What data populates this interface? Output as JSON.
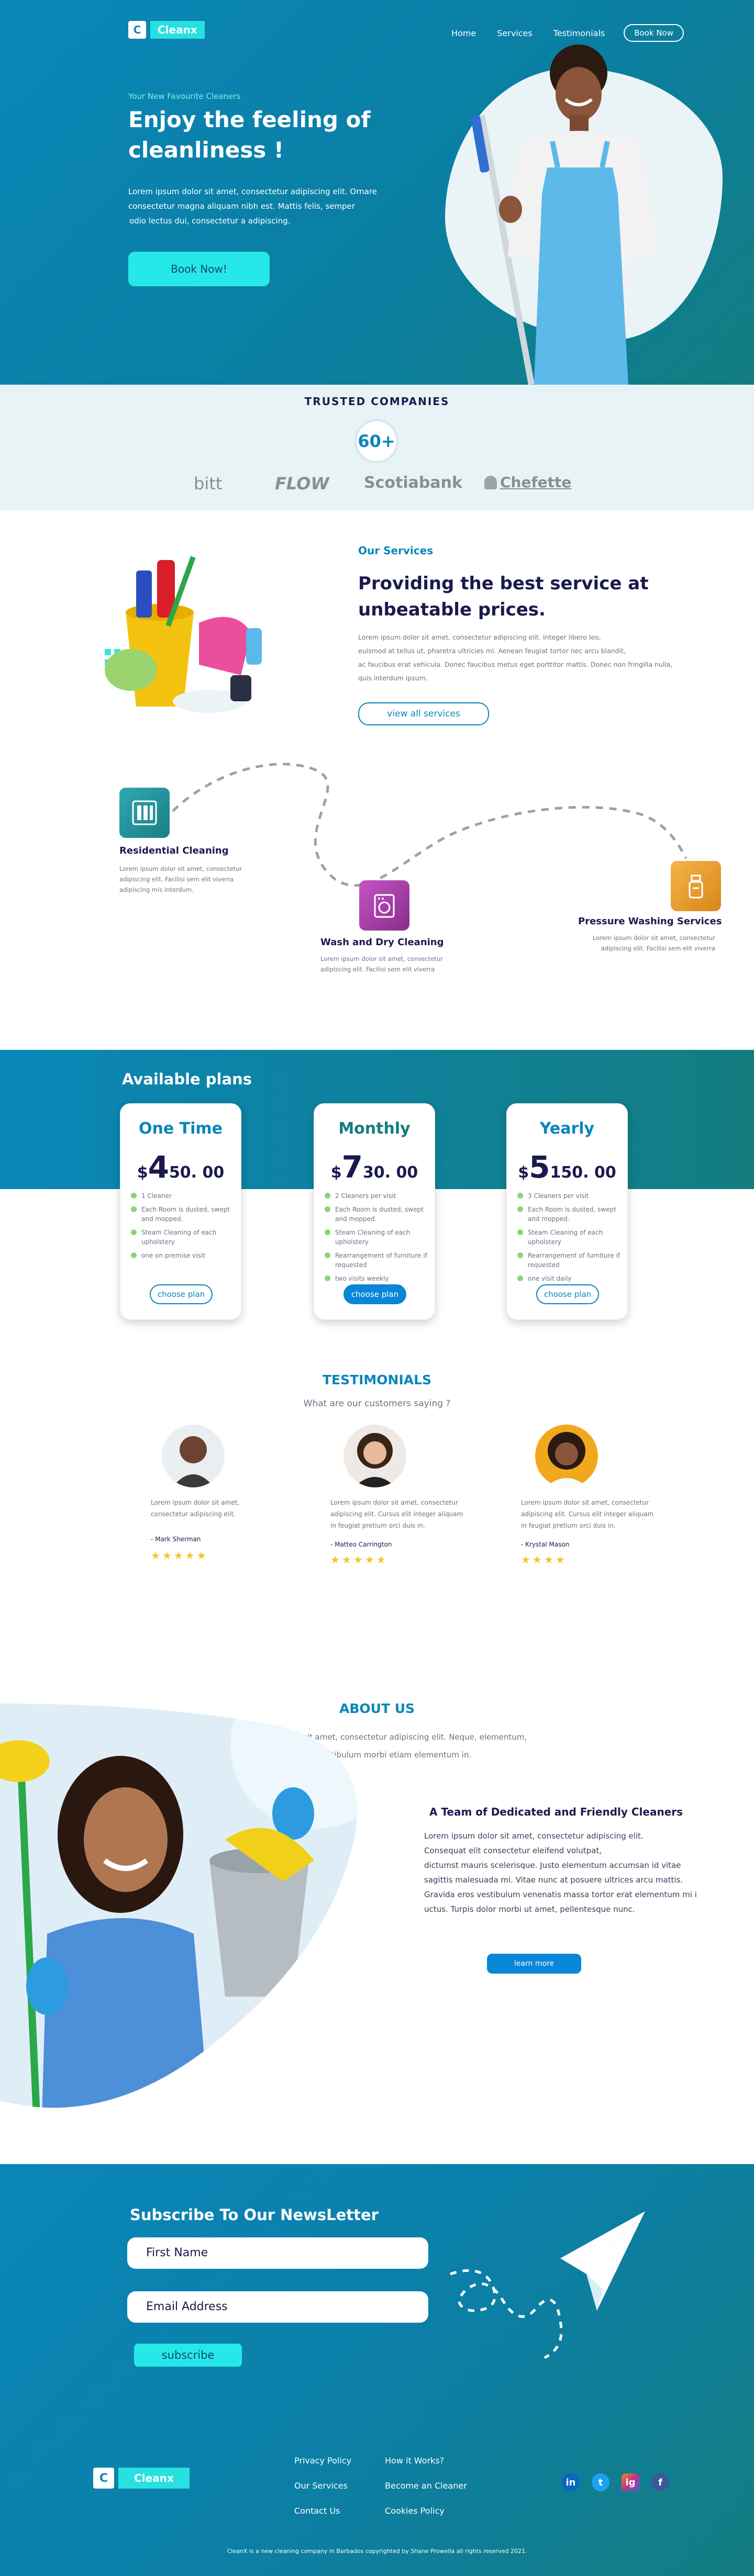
{
  "header": {
    "logo_letter": "C",
    "logo_text": "Cleanx",
    "nav": [
      "Home",
      "Services",
      "Testimonials"
    ],
    "book_label": "Book Now"
  },
  "hero": {
    "eyebrow": "Your New Favourite Cleaners",
    "title_line1": "Enjoy the feeling of",
    "title_line2": "cleanliness !",
    "para_line1": "Lorem ipsum dolor sit amet, consectetur adipiscing elit. Ornare",
    "para_line2": "consectetur magna aliquam nibh est. Mattis felis, semper",
    "para_line3": "odio lectus dui, consectetur a adipiscing.",
    "cta": "Book Now!"
  },
  "trusted": {
    "title": "TRUSTED COMPANIES",
    "count": "60+",
    "brands": [
      "bitt",
      "FLOW",
      "Scotiabank",
      "Chefette"
    ]
  },
  "services": {
    "eyebrow": "Our Services",
    "title_line1": "Providing the best service at",
    "title_line2": "unbeatable prices.",
    "para_line1": "Lorem ipsum dolor sit amet, consectetur adipiscing elit. Integer libero leo,",
    "para_line2": "euismod at tellus ut, pharetra ultricies mi. Aenean feugiat tortor nec arcu blandit,",
    "para_line3": "ac faucibus erat vehicula. Donec faucibus metus eget porttitor mattis. Donec non fringilla nulla,",
    "para_line4": "quis interdum ipsum.",
    "button": "view all services",
    "items": [
      {
        "title": "Residential Cleaning",
        "l1": "Lorem ipsum dolor sit amet, consectetur",
        "l2": "adipiscing elit. Facilisi sem elit viverra",
        "l3": "adipiscing mis interdum."
      },
      {
        "title": "Wash and Dry Cleaning",
        "l1": "Lorem ipsum dolor sit amet, consectetur",
        "l2": "adipiscing elit. Facilisi sem elit viverra"
      },
      {
        "title": "Pressure Washing Services",
        "l1": "Lorem ipsum dolor sit amet, consectetur",
        "l2": "adipiscing elit. Facilisi sem elit viverra"
      }
    ]
  },
  "plans": {
    "title": "Available plans",
    "cards": [
      {
        "name": "One Time",
        "dollar": "$",
        "big": "4",
        "small": "50. 00",
        "features": [
          "1 Cleaner",
          "Each Room is dusted, swept and mopped.",
          "Steam Cleaning of each upholstery",
          "one on premise visit"
        ],
        "button": "choose plan"
      },
      {
        "name": "Monthly",
        "dollar": "$",
        "big": "7",
        "small": "30. 00",
        "features": [
          "2 Cleaners per visit",
          "Each Room is dusted, swept and mopped.",
          "Steam Cleaning of each upholstery",
          "Rearrangement of furniture if requested",
          "two visits weekly"
        ],
        "button": "choose plan"
      },
      {
        "name": "Yearly",
        "dollar": "$",
        "big": "5",
        "small": "150. 00",
        "features": [
          "3 Cleaners per visit",
          "Each Room is dusted, swept and mopped.",
          "Steam Cleaning of each upholstery",
          "Rearrangement of furniture if requested",
          "one visit daily"
        ],
        "button": "choose plan"
      }
    ]
  },
  "testimonials": {
    "title": "TESTIMONIALS",
    "subtitle": "What are our customers saying ?",
    "items": [
      {
        "l1": "Lorem ipsum dolor sit amet,",
        "l2": "consectetur adipiscing elit.",
        "name": "- Mark Sherman",
        "stars": "★★★★★"
      },
      {
        "l1": "Lorem ipsum dolor sit amet, consectetur",
        "l2": "adipiscing elit. Cursus elit integer aliquam",
        "l3": "in feugiat pretium orci duis in.",
        "name": "- Matteo Carrington",
        "stars": "★★★★★"
      },
      {
        "l1": "Lorem ipsum dolor sit amet, consectetur",
        "l2": "adipiscing elit. Cursus elit integer aliquam",
        "l3": "in feugiat pretium orci duis in.",
        "name": "- Krystal Mason",
        "stars": "★★★★"
      }
    ]
  },
  "about": {
    "title": "ABOUT US",
    "intro_l1": "Lorem ipsum dolor sit amet, consectetur adipiscing elit. Neque, elementum,",
    "intro_l2": "volutpat vestibulum morbi etiam elementum in.",
    "subtitle": "A Team of Dedicated and Friendly Cleaners",
    "lines": [
      "Lorem ipsum dolor sit amet, consectetur adipiscing elit.",
      "Consequat elit consectetur eleifend volutpat,",
      "dictumst mauris scelerisque. Justo elementum accumsan id vitae",
      "sagittis malesuada mi. Vitae nunc at posuere ultrices arcu mattis.",
      "Gravida eros vestibulum venenatis massa tortor erat elementum mi i",
      "uctus. Turpis dolor morbi ut amet, pellentesque nunc."
    ],
    "button": "learn more"
  },
  "newsletter": {
    "title": "Subscribe To Our NewsLetter",
    "first_name": "First Name",
    "email": "Email Address",
    "button": "subscribe"
  },
  "footer": {
    "links_col1": [
      "Privacy Policy",
      "Our Services",
      "Contact Us"
    ],
    "links_col2": [
      "How it Works?",
      "Become an Cleaner",
      "Cookies Policy"
    ],
    "socials": [
      {
        "name": "in",
        "color": "#0a66c2"
      },
      {
        "name": "t",
        "color": "#1da1f2"
      },
      {
        "name": "ig",
        "color": "#c13584"
      },
      {
        "name": "f",
        "color": "#3b5998"
      }
    ],
    "copyright": "CleanX is a new cleaning company in Barbados copyrighted by Shane Prowella all rights reserved 2021."
  },
  "colors": {
    "primary": "#0a86b8",
    "accent": "#27e8e8",
    "dark": "#1a1a4e",
    "teal": "#137d80"
  }
}
